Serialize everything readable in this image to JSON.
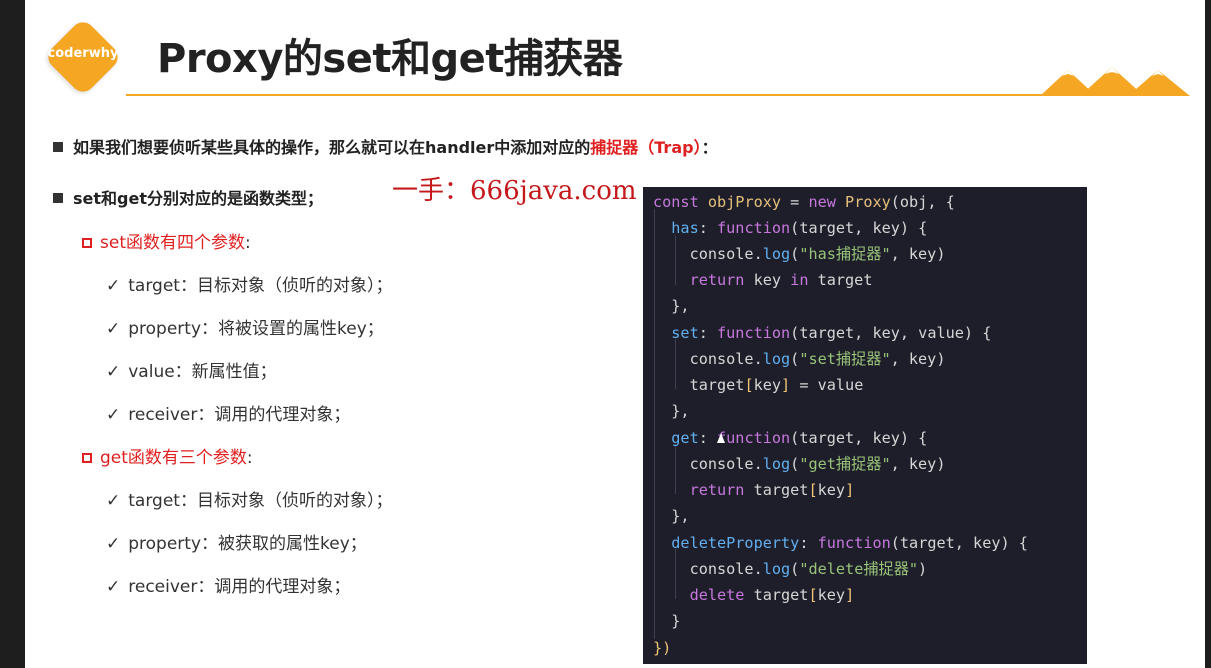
{
  "logo": {
    "text": "coderwhy"
  },
  "title": "Proxy的set和get捕获器",
  "bullets": [
    {
      "pre": "如果我们想要侦听某些具体的操作，那么就可以在handler中添加对应的",
      "highlight": "捕捉器（Trap）",
      "post": "："
    },
    {
      "text": "set和get分别对应的是函数类型；"
    }
  ],
  "watermark": "一手：666java.com",
  "set_section": {
    "heading": "set函数有四个参数",
    "items": [
      "target：目标对象（侦听的对象）；",
      "property：将被设置的属性key；",
      "value：新属性值；",
      "receiver：调用的代理对象；"
    ]
  },
  "get_section": {
    "heading": "get函数有三个参数",
    "items": [
      "target：目标对象（侦听的对象）；",
      "property：被获取的属性key；",
      "receiver：调用的代理对象；"
    ]
  },
  "code_lines": [
    "const objProxy = new Proxy(obj, {",
    "  has: function(target, key) {",
    "    console.log(\"has捕捉器\", key)",
    "    return key in target",
    "  },",
    "  set: function(target, key, value) {",
    "    console.log(\"set捕捉器\", key)",
    "    target[key] = value",
    "  },",
    "  get: function(target, key) {",
    "    console.log(\"get捕捉器\", key)",
    "    return target[key]",
    "  },",
    "  deleteProperty: function(target, key) {",
    "    console.log(\"delete捕捉器\")",
    "    delete target[key]",
    "  }",
    "})"
  ],
  "colors": {
    "accent": "#f5a623",
    "highlight_red": "#e02020",
    "code_bg": "#1e1e2a"
  }
}
